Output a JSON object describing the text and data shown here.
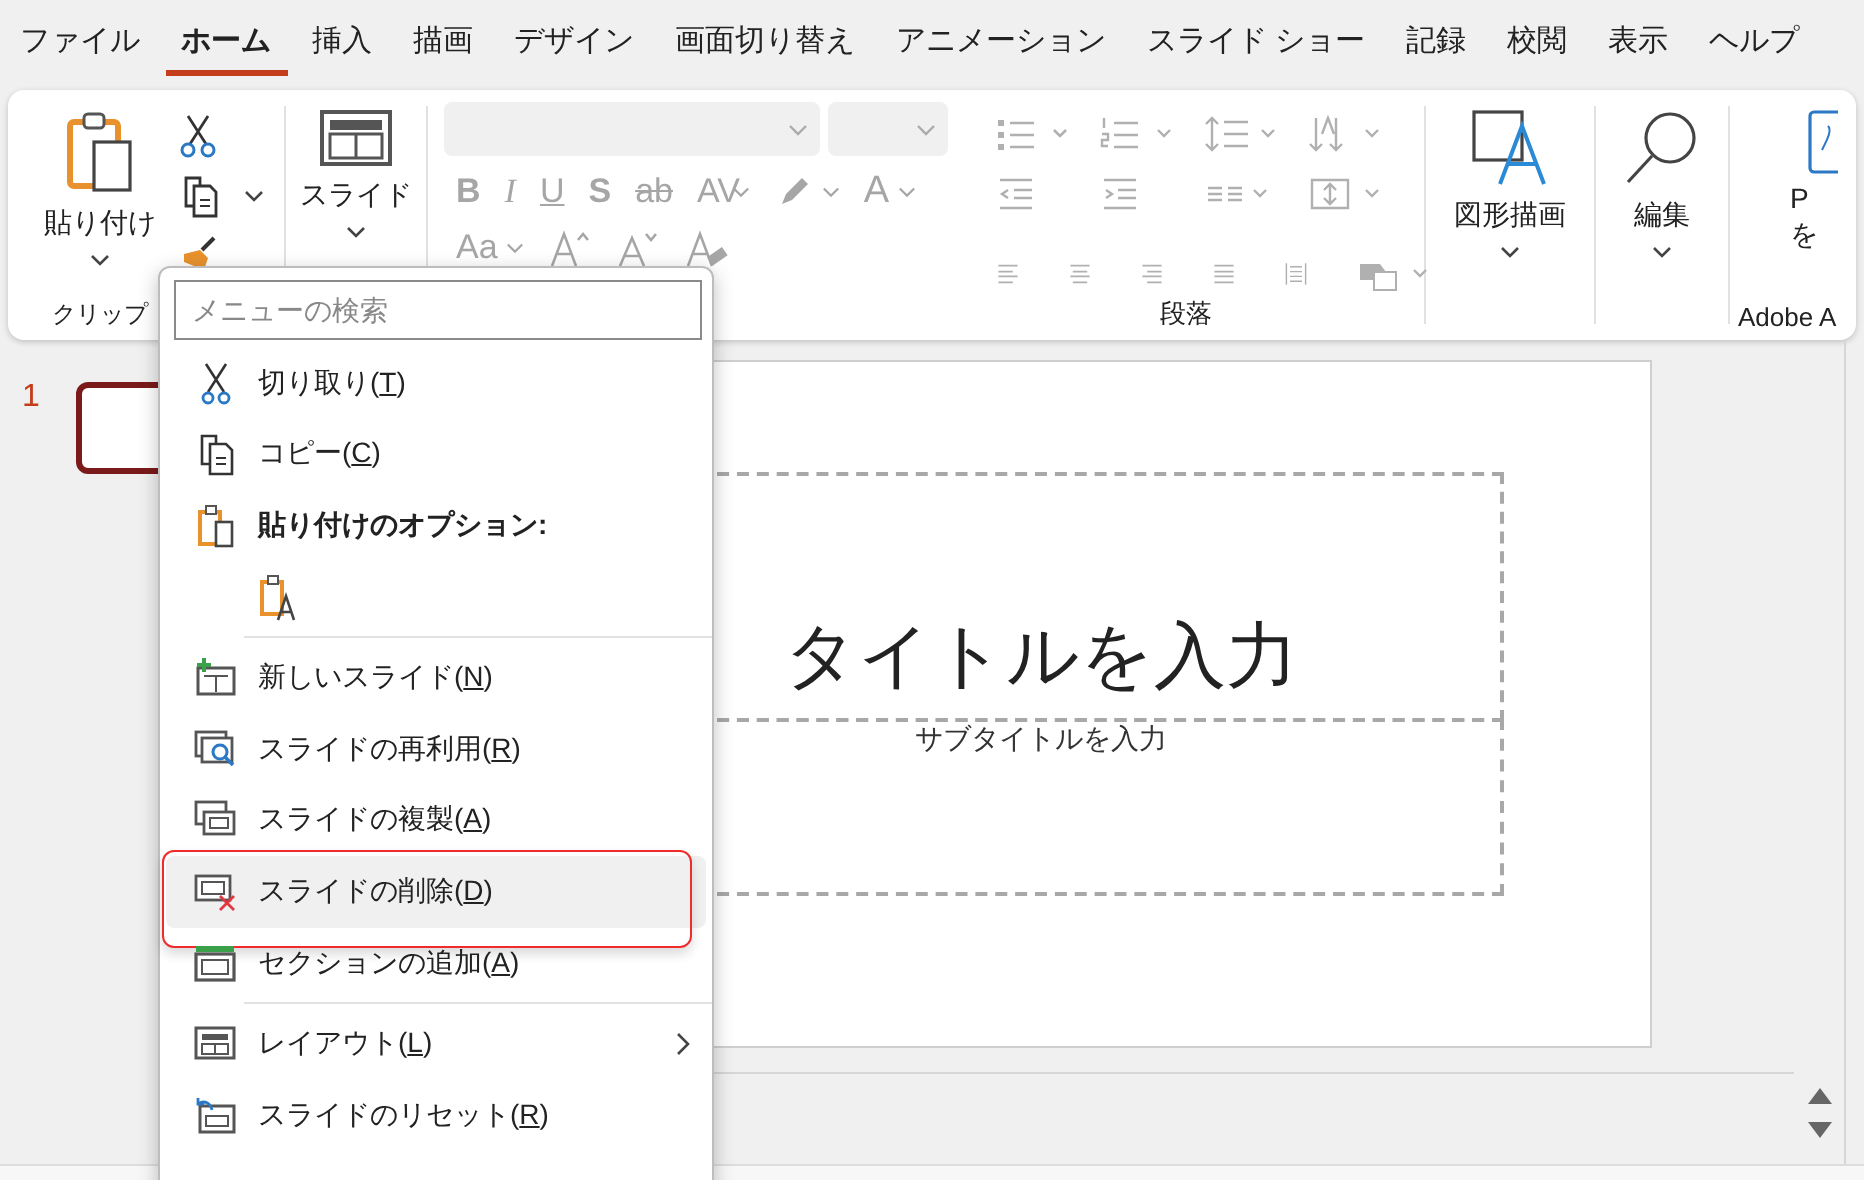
{
  "tabs": [
    {
      "label": "ファイル",
      "selected": false
    },
    {
      "label": "ホーム",
      "selected": true
    },
    {
      "label": "挿入",
      "selected": false
    },
    {
      "label": "描画",
      "selected": false
    },
    {
      "label": "デザイン",
      "selected": false
    },
    {
      "label": "画面切り替え",
      "selected": false
    },
    {
      "label": "アニメーション",
      "selected": false
    },
    {
      "label": "スライド ショー",
      "selected": false
    },
    {
      "label": "記録",
      "selected": false
    },
    {
      "label": "校閲",
      "selected": false
    },
    {
      "label": "表示",
      "selected": false
    },
    {
      "label": "ヘルプ",
      "selected": false
    }
  ],
  "ribbon": {
    "clipboard": {
      "paste_button": "貼り付け",
      "group_label": "クリップ"
    },
    "slides": {
      "new_slide_button": "スライド"
    },
    "font": {
      "disabled": true,
      "tools": [
        {
          "kind": "text",
          "label": "B",
          "dropdown": false
        },
        {
          "kind": "text",
          "label": "I",
          "dropdown": false
        },
        {
          "kind": "text",
          "label": "U",
          "dropdown": false
        },
        {
          "kind": "text",
          "label": "S",
          "dropdown": false
        },
        {
          "kind": "text",
          "label": "ab",
          "dropdown": false
        },
        {
          "kind": "text",
          "label": "AV",
          "dropdown": true
        },
        {
          "kind": "icon",
          "dropdown": true
        },
        {
          "kind": "text",
          "label": "A",
          "dropdown": true
        },
        {
          "kind": "text",
          "label": "Aa",
          "dropdown": true
        },
        {
          "kind": "icon",
          "dropdown": false
        },
        {
          "kind": "icon",
          "dropdown": false
        },
        {
          "kind": "icon",
          "dropdown": false
        }
      ]
    },
    "paragraph": {
      "disabled": true,
      "group_label": "段落"
    },
    "drawing": {
      "button": "図形描画"
    },
    "editing": {
      "button": "編集"
    },
    "adobe": {
      "button_lines": [
        "P",
        "を"
      ],
      "group_label": "Adobe A"
    }
  },
  "slide_pane": {
    "number": "1",
    "thumbnail_selected": true
  },
  "slide": {
    "title_placeholder": "タイトルを入力",
    "subtitle_placeholder": "サブタイトルを入力"
  },
  "context_menu": {
    "search": {
      "placeholder": "メニューの検索"
    },
    "items": [
      {
        "kind": "command",
        "before": "切り取り(",
        "key": "T",
        "after": ")",
        "highlighted": false,
        "annotated": false,
        "submenu": false
      },
      {
        "kind": "command",
        "before": "コピー(",
        "key": "C",
        "after": ")",
        "highlighted": false,
        "annotated": false,
        "submenu": false
      },
      {
        "kind": "header",
        "label": "貼り付けのオプション:"
      },
      {
        "kind": "paste_option"
      },
      {
        "kind": "divider"
      },
      {
        "kind": "command",
        "before": "新しいスライド(",
        "key": "N",
        "after": ")",
        "highlighted": false,
        "annotated": false,
        "submenu": false
      },
      {
        "kind": "command",
        "before": "スライドの再利用(",
        "key": "R",
        "after": ")",
        "highlighted": false,
        "annotated": false,
        "submenu": false
      },
      {
        "kind": "command",
        "before": "スライドの複製(",
        "key": "A",
        "after": ")",
        "highlighted": false,
        "annotated": false,
        "submenu": false
      },
      {
        "kind": "command",
        "before": "スライドの削除(",
        "key": "D",
        "after": ")",
        "highlighted": true,
        "annotated": true,
        "submenu": false
      },
      {
        "kind": "command",
        "before": "セクションの追加(",
        "key": "A",
        "after": ")",
        "highlighted": false,
        "annotated": false,
        "submenu": false
      },
      {
        "kind": "divider"
      },
      {
        "kind": "command",
        "before": "レイアウト(",
        "key": "L",
        "after": ")",
        "highlighted": false,
        "annotated": false,
        "submenu": true
      },
      {
        "kind": "command",
        "before": "スライドのリセット(",
        "key": "R",
        "after": ")",
        "highlighted": false,
        "annotated": false,
        "submenu": false
      }
    ]
  }
}
